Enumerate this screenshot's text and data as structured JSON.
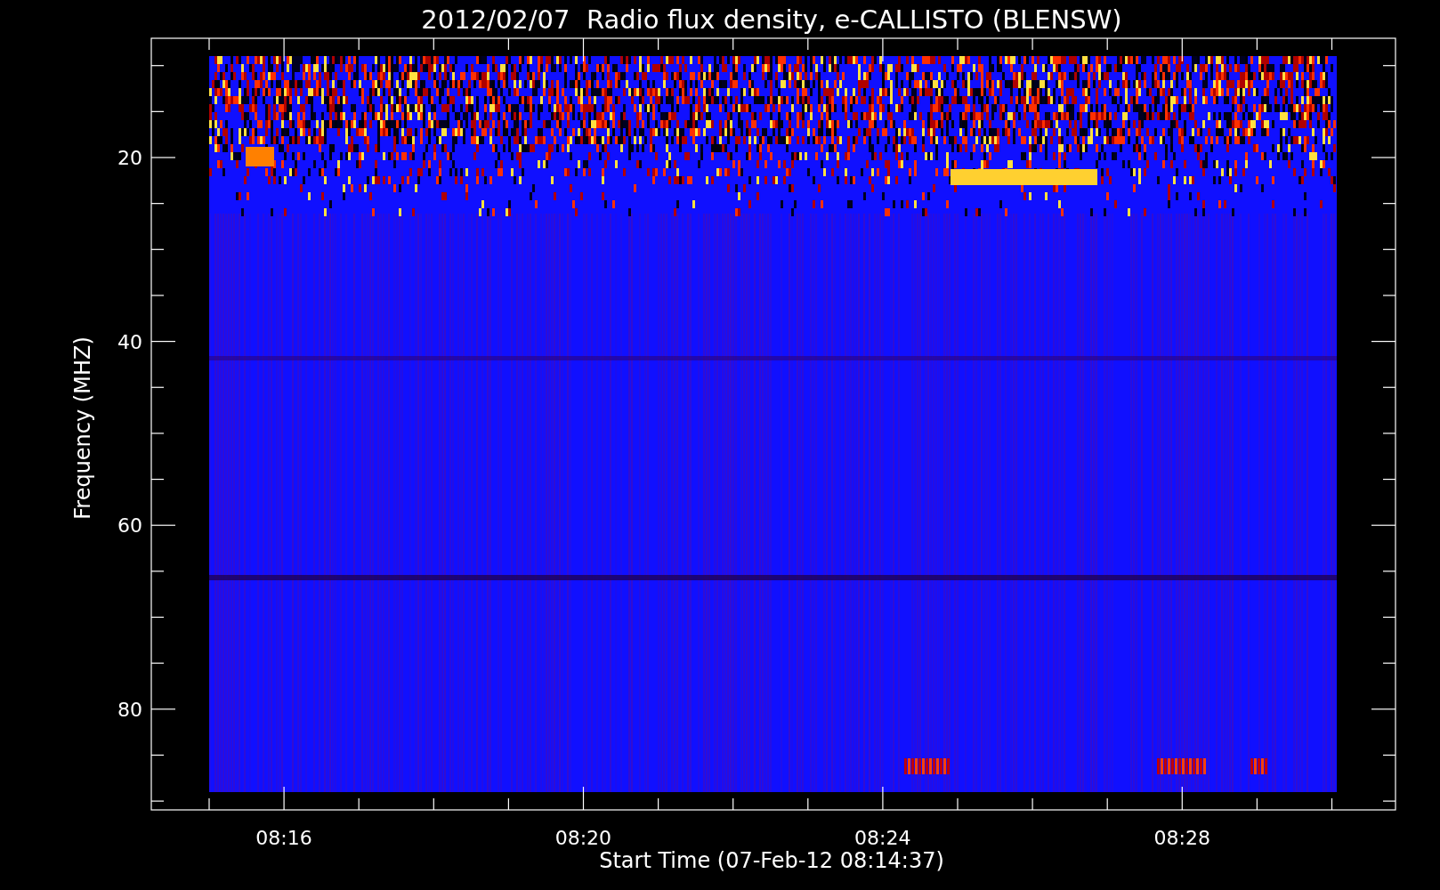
{
  "title": "2012/02/07  Radio flux density, e-CALLISTO (BLENSW)",
  "y_axis": {
    "label": "Frequency (MHZ)",
    "ticks": [
      "20",
      "40",
      "60",
      "80"
    ]
  },
  "x_axis": {
    "label": "Start Time (07-Feb-12 08:14:37)",
    "ticks": [
      "08:16",
      "08:20",
      "08:24",
      "08:28"
    ]
  }
}
